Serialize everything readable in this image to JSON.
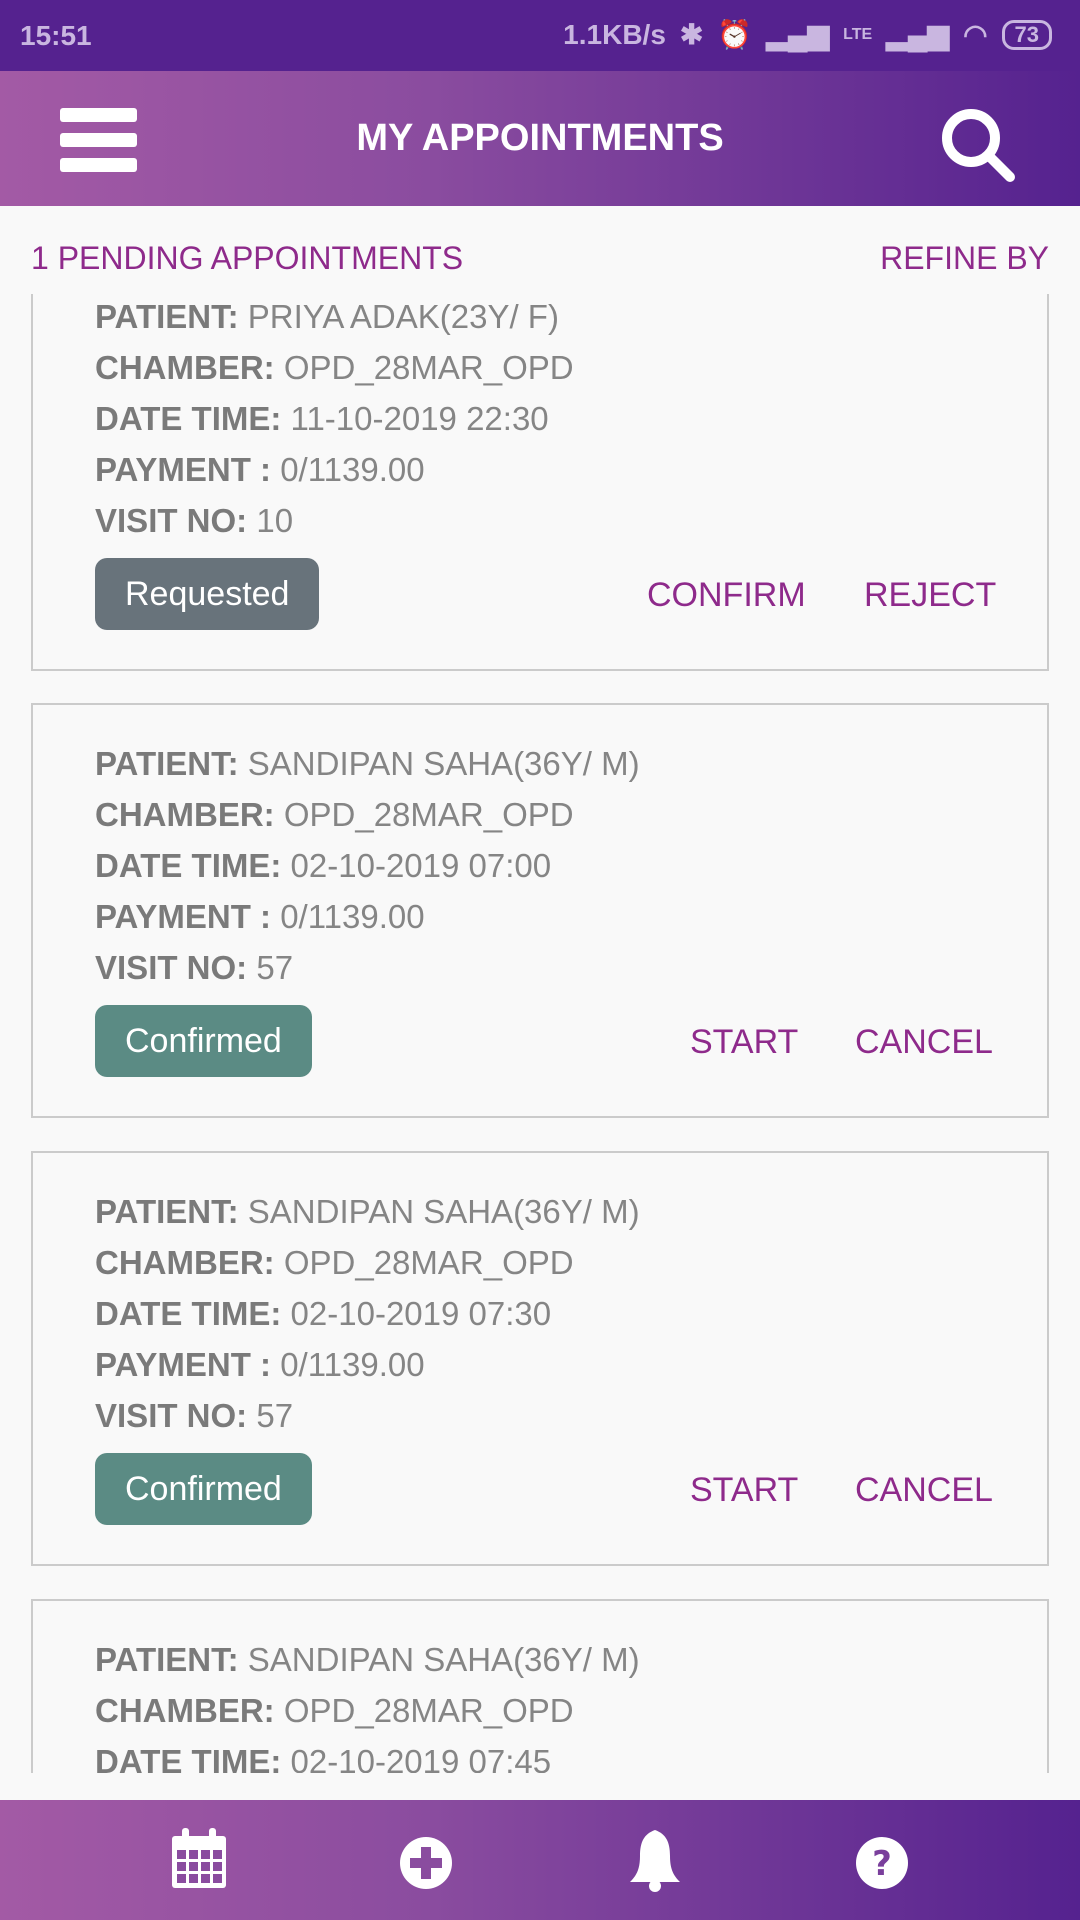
{
  "status_bar": {
    "time": "15:51",
    "network_speed": "1.1KB/s",
    "battery": "73"
  },
  "header": {
    "title": "MY APPOINTMENTS"
  },
  "subbar": {
    "pending": "1 PENDING APPOINTMENTS",
    "refine": "REFINE BY"
  },
  "labels": {
    "patient": "PATIENT:",
    "chamber": "CHAMBER:",
    "datetime": "DATE TIME:",
    "payment": "PAYMENT :",
    "visit": "VISIT NO:"
  },
  "appointments": [
    {
      "patient": "PRIYA ADAK(23Y/ F)",
      "chamber": "OPD_28MAR_OPD",
      "datetime": "11-10-2019 22:30",
      "payment": "0/1139.00",
      "visit": "10",
      "status": "Requested",
      "status_color": "#68737b",
      "action1": "CONFIRM",
      "action2": "REJECT"
    },
    {
      "patient": "SANDIPAN SAHA(36Y/ M)",
      "chamber": "OPD_28MAR_OPD",
      "datetime": "02-10-2019 07:00",
      "payment": "0/1139.00",
      "visit": "57",
      "status": "Confirmed",
      "status_color": "#5b8b84",
      "action1": "START",
      "action2": "CANCEL"
    },
    {
      "patient": "SANDIPAN SAHA(36Y/ M)",
      "chamber": "OPD_28MAR_OPD",
      "datetime": "02-10-2019 07:30",
      "payment": "0/1139.00",
      "visit": "57",
      "status": "Confirmed",
      "status_color": "#5b8b84",
      "action1": "START",
      "action2": "CANCEL"
    },
    {
      "patient": "SANDIPAN SAHA(36Y/ M)",
      "chamber": "OPD_28MAR_OPD",
      "datetime": "02-10-2019 07:45"
    }
  ],
  "bottom_nav": [
    "calendar-icon",
    "add-circle-icon",
    "bell-icon",
    "help-icon"
  ]
}
